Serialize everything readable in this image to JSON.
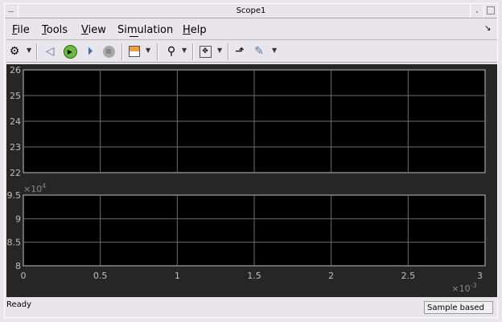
{
  "window": {
    "title": "Scope1"
  },
  "menu": [
    "File",
    "Tools",
    "View",
    "Simulation",
    "Help"
  ],
  "menu_mnemonics": [
    "F",
    "T",
    "V",
    "m",
    "H"
  ],
  "toolbar": {
    "icons": [
      "settings-icon",
      "step-back-icon",
      "run-icon",
      "step-forward-icon",
      "stop-icon",
      "signal-selector-icon",
      "zoom-icon",
      "autoscale-icon",
      "highlight-simulink-block-icon",
      "measurements-icon"
    ]
  },
  "status": {
    "text": "Ready",
    "mode": "Sample based"
  },
  "chart_data": [
    {
      "type": "line",
      "ylim": [
        22,
        26
      ],
      "yticks": [
        "22",
        "23",
        "24",
        "25",
        "26"
      ],
      "xlim": [
        0,
        0.003
      ],
      "grid": true,
      "series": []
    },
    {
      "type": "line",
      "ylim": [
        80000,
        95000
      ],
      "yticks": [
        "8",
        "8.5",
        "9",
        "9.5"
      ],
      "yexponent": "×10",
      "yexp": "4",
      "xlim": [
        0,
        0.003
      ],
      "xticks": [
        "0",
        "0.5",
        "1",
        "1.5",
        "2",
        "2.5",
        "3"
      ],
      "xexponent": "×10",
      "xexp": "-3",
      "grid": true,
      "series": []
    }
  ],
  "colors": {
    "plot_bg": "#000000",
    "figure_bg": "#262626",
    "grid": "#6e6e6e",
    "axis": "#bfbfbf"
  }
}
